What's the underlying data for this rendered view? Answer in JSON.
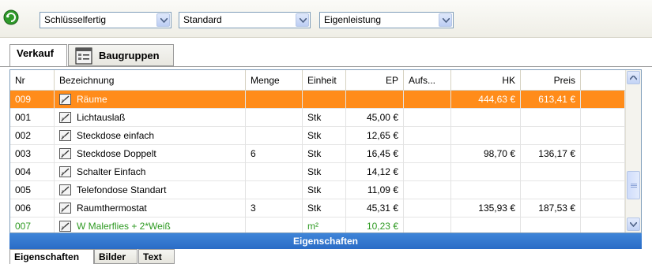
{
  "toolbar": {
    "app_icon": "refresh-green-icon",
    "combo1_value": "Schlüsselfertig",
    "combo2_value": "Standard",
    "combo3_value": "Eigenleistung"
  },
  "tabs": {
    "verkauf": "Verkauf",
    "baugruppen": "Baugruppen",
    "baugruppen_icon": "list-window-icon"
  },
  "table": {
    "headers": {
      "nr": "Nr",
      "bezeichnung": "Bezeichnung",
      "menge": "Menge",
      "einheit": "Einheit",
      "ep": "EP",
      "aufs": "Aufs...",
      "hk": "HK",
      "preis": "Preis"
    },
    "rows": [
      {
        "nr": "009",
        "bezeichnung": "Räume",
        "menge": "",
        "einheit": "",
        "ep": "",
        "aufs": "",
        "hk": "444,63 €",
        "preis": "613,41 €",
        "selected": true
      },
      {
        "nr": "001",
        "bezeichnung": "Lichtauslaß",
        "menge": "",
        "einheit": "Stk",
        "ep": "45,00 €",
        "aufs": "",
        "hk": "",
        "preis": ""
      },
      {
        "nr": "002",
        "bezeichnung": "Steckdose einfach",
        "menge": "",
        "einheit": "Stk",
        "ep": "12,65 €",
        "aufs": "",
        "hk": "",
        "preis": ""
      },
      {
        "nr": "003",
        "bezeichnung": "Steckdose Doppelt",
        "menge": "6",
        "einheit": "Stk",
        "ep": "16,45 €",
        "aufs": "",
        "hk": "98,70 €",
        "preis": "136,17 €"
      },
      {
        "nr": "004",
        "bezeichnung": "Schalter Einfach",
        "menge": "",
        "einheit": "Stk",
        "ep": "14,12 €",
        "aufs": "",
        "hk": "",
        "preis": ""
      },
      {
        "nr": "005",
        "bezeichnung": "Telefondose Standart",
        "menge": "",
        "einheit": "Stk",
        "ep": "11,09 €",
        "aufs": "",
        "hk": "",
        "preis": ""
      },
      {
        "nr": "006",
        "bezeichnung": "Raumthermostat",
        "menge": "3",
        "einheit": "Stk",
        "ep": "45,31 €",
        "aufs": "",
        "hk": "135,93 €",
        "preis": "187,53 €"
      },
      {
        "nr": "007",
        "bezeichnung": "W Malerflies + 2*Weiß",
        "menge": "",
        "einheit": "m²",
        "ep": "10,23 €",
        "aufs": "",
        "hk": "",
        "preis": "",
        "partial": true
      }
    ]
  },
  "properties": {
    "title": "Eigenschaften",
    "tabs": [
      "Eigenschaften",
      "Bilder",
      "Text"
    ]
  },
  "colors": {
    "selected_row": "#ff8c1a",
    "properties_bar": "#2f74cf",
    "partial_row_text": "#2e9a22"
  }
}
